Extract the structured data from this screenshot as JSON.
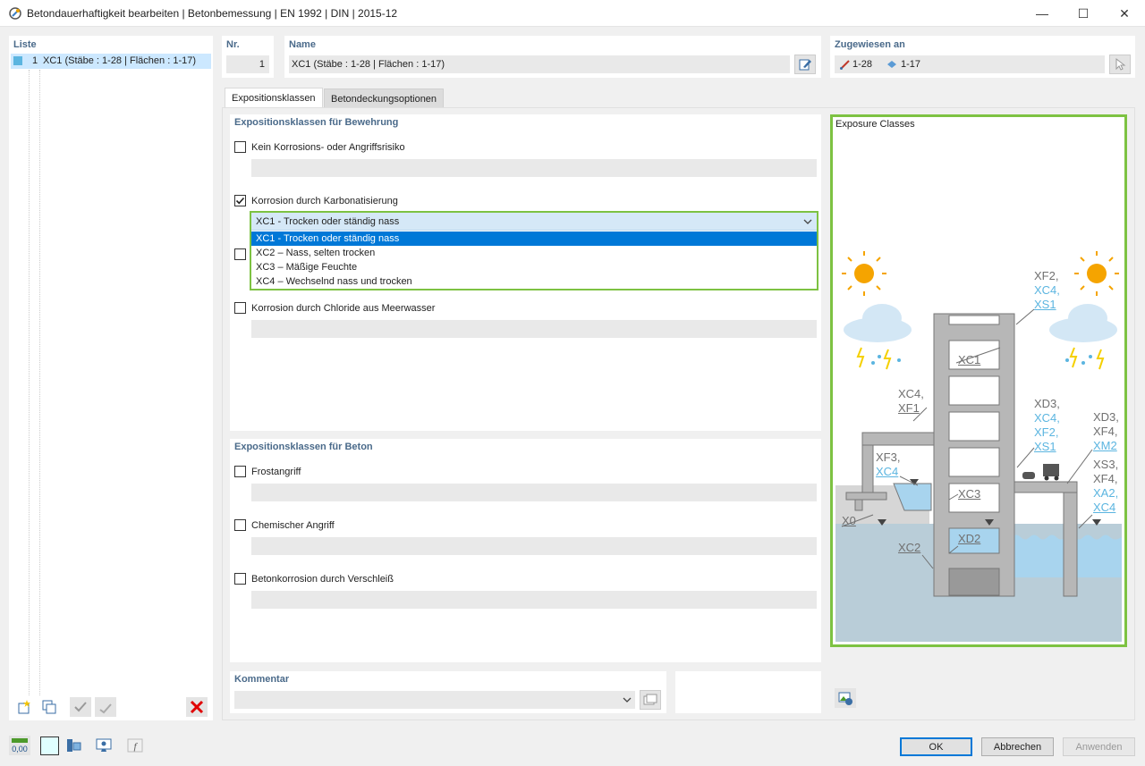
{
  "window": {
    "title": "Betondauerhaftigkeit bearbeiten | Betonbemessung | EN 1992 | DIN | 2015-12",
    "min_label": "—",
    "max_label": "☐",
    "close_label": "✕"
  },
  "list": {
    "header": "Liste",
    "items": [
      {
        "number": "1",
        "label": "XC1 (Stäbe : 1-28 | Flächen : 1-17)",
        "color": "#5b9bd5"
      }
    ]
  },
  "nr": {
    "header": "Nr.",
    "value": "1"
  },
  "name": {
    "header": "Name",
    "value": "XC1 (Stäbe : 1-28 | Flächen : 1-17)"
  },
  "assigned": {
    "header": "Zugewiesen an",
    "members": "1-28",
    "surfaces": "1-17"
  },
  "tabs": [
    {
      "label": "Expositionsklassen"
    },
    {
      "label": "Betondeckungsoptionen"
    }
  ],
  "reinforcement": {
    "header": "Expositionsklassen für Bewehrung",
    "options": [
      {
        "label": "Kein Korrosions- oder Angriffsrisiko",
        "checked": false
      },
      {
        "label": "Korrosion durch Karbonatisierung",
        "checked": true
      },
      {
        "label": "",
        "checked": false
      },
      {
        "label": "Korrosion durch Chloride aus Meerwasser",
        "checked": false
      }
    ],
    "dropdown": {
      "selected": "XC1 - Trocken oder ständig nass",
      "options": [
        "XC1 - Trocken oder ständig nass",
        "XC2 – Nass, selten trocken",
        "XC3 – Mäßige Feuchte",
        "XC4 – Wechselnd nass und trocken"
      ]
    }
  },
  "concrete": {
    "header": "Expositionsklassen für Beton",
    "options": [
      {
        "label": "Frostangriff",
        "checked": false
      },
      {
        "label": "Chemischer Angriff",
        "checked": false
      },
      {
        "label": "Betonkorrosion durch Verschleiß",
        "checked": false
      }
    ]
  },
  "comment": {
    "header": "Kommentar",
    "value": ""
  },
  "figure": {
    "title": "Exposure Classes",
    "labels": {
      "xf2": "XF2,",
      "xc4a": "XC4,",
      "xs1a": "XS1",
      "xc1": "XC1",
      "xc4b": "XC4,",
      "xf1": "XF1",
      "xd3a": "XD3,",
      "xc4c": "XC4,",
      "xf2b": "XF2,",
      "xs1b": "XS1",
      "xd3b": "XD3,",
      "xf4a": "XF4,",
      "xm2": "XM2",
      "xf3": "XF3,",
      "xc4d": "XC4",
      "xs3": "XS3,",
      "xf4b": "XF4,",
      "xa2": "XA2,",
      "xc4e": "XC4",
      "xc3": "XC3",
      "x0": "X0",
      "xd2": "XD2",
      "xc2": "XC2"
    },
    "colors": {
      "gray": "#707070",
      "blue": "#5bb5e0",
      "water": "#a8d4ee",
      "deep": "#b9cdd8",
      "wall": "#b7b7b7",
      "sun": "#f5a400"
    }
  },
  "buttons": {
    "ok": "OK",
    "cancel": "Abbrechen",
    "apply": "Anwenden"
  },
  "bottom_icons": {
    "zero": "0,00"
  }
}
